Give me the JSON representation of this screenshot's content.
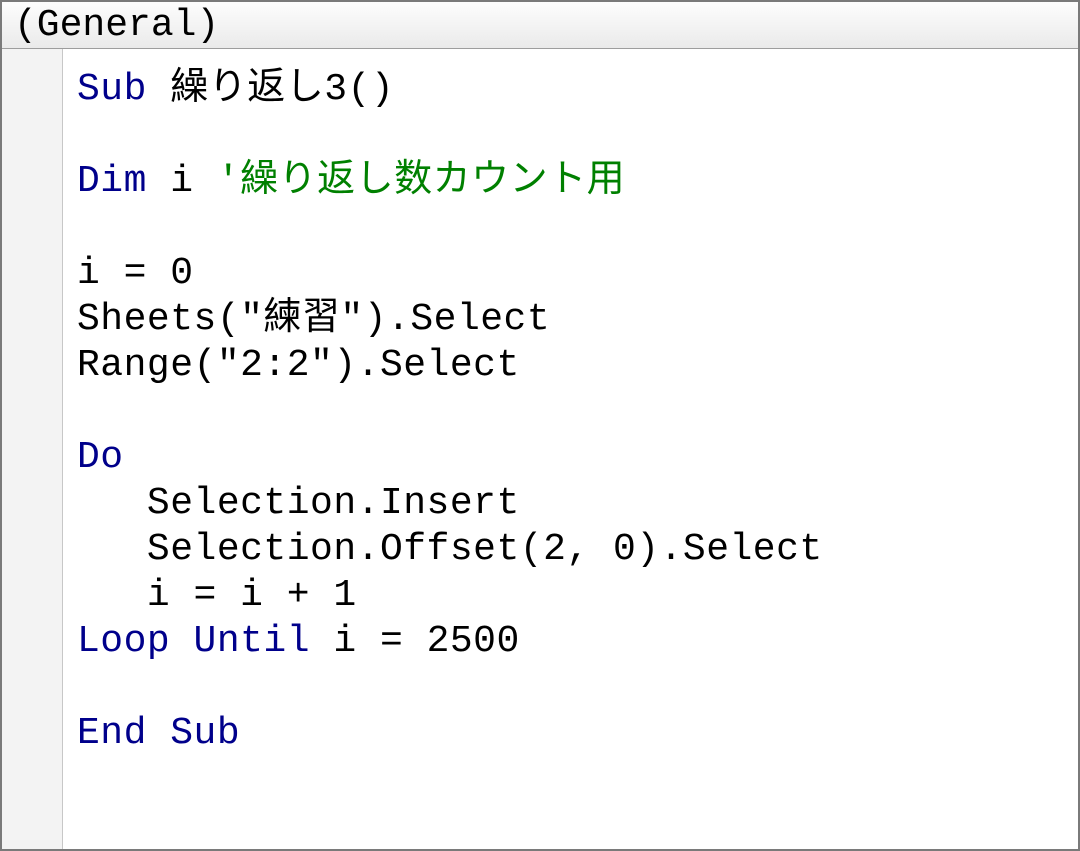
{
  "dropdown": {
    "label": "(General)"
  },
  "code": {
    "sub_kw": "Sub",
    "sub_name": " 繰り返し3()",
    "dim_kw": "Dim",
    "dim_rest": " i ",
    "dim_comment": "'繰り返し数カウント用",
    "line_i0": "i = 0",
    "line_sheets": "Sheets(\"練習\").Select",
    "line_range": "Range(\"2:2\").Select",
    "do_kw": "Do",
    "line_insert": "   Selection.Insert",
    "line_offset": "   Selection.Offset(2, 0).Select",
    "line_iinc": "   i = i + 1",
    "loop_kw": "Loop Until",
    "loop_rest": " i = 2500",
    "end_kw": "End Sub"
  }
}
